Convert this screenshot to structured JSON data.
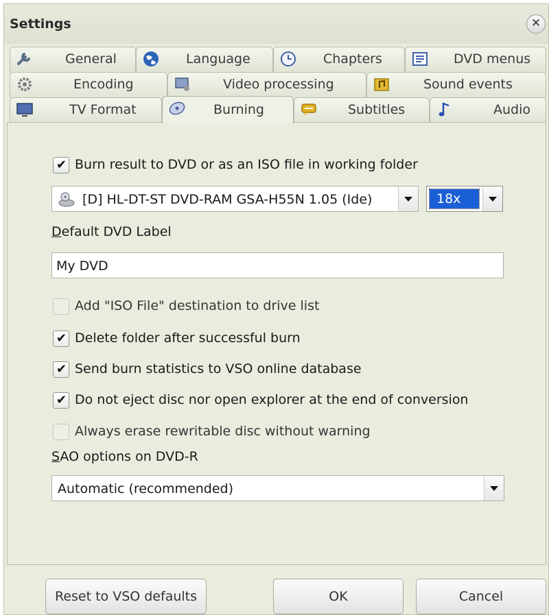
{
  "window": {
    "title": "Settings"
  },
  "tabs": {
    "row1": [
      {
        "label": "General",
        "icon": "wrench-icon"
      },
      {
        "label": "Language",
        "icon": "globe-icon"
      },
      {
        "label": "Chapters",
        "icon": "clock-icon"
      },
      {
        "label": "DVD menus",
        "icon": "menu-icon"
      }
    ],
    "row2": [
      {
        "label": "Encoding",
        "icon": "gear-icon"
      },
      {
        "label": "Video processing",
        "icon": "video-screen-icon"
      },
      {
        "label": "Sound events",
        "icon": "music-folder-icon"
      }
    ],
    "row3": [
      {
        "label": "TV Format",
        "icon": "tv-icon"
      },
      {
        "label": "Burning",
        "icon": "disc-icon",
        "active": true
      },
      {
        "label": "Subtitles",
        "icon": "subtitle-icon"
      },
      {
        "label": "Audio",
        "icon": "music-note-icon"
      }
    ]
  },
  "burning": {
    "burn_result_label": "Burn result to DVD or as an ISO file in working folder",
    "burn_result_checked": true,
    "drive_value": "[D] HL-DT-ST DVD-RAM GSA-H55N 1.05 (Ide)",
    "speed_value": "18x",
    "label_title_first": "D",
    "label_title_rest": "efault DVD Label",
    "label_value": "My DVD",
    "options": [
      {
        "label": "Add \"ISO File\" destination to drive list",
        "checked": false,
        "enabled": false
      },
      {
        "label": "Delete folder after successful burn",
        "checked": true,
        "enabled": true
      },
      {
        "label": "Send burn statistics to VSO online database",
        "checked": true,
        "enabled": true
      },
      {
        "label": "Do not eject disc nor open explorer at the end of conversion",
        "checked": true,
        "enabled": true
      },
      {
        "label": "Always erase rewritable disc without warning",
        "checked": false,
        "enabled": false
      }
    ],
    "sao_title_first": "S",
    "sao_title_rest": "AO options on DVD-R",
    "sao_value": "Automatic (recommended)"
  },
  "footer": {
    "reset_label": "Reset to VSO defaults",
    "ok_label": "OK",
    "cancel_label": "Cancel"
  },
  "colors": {
    "panel_bg": "#e8edde",
    "selection": "#1b5fd6"
  }
}
